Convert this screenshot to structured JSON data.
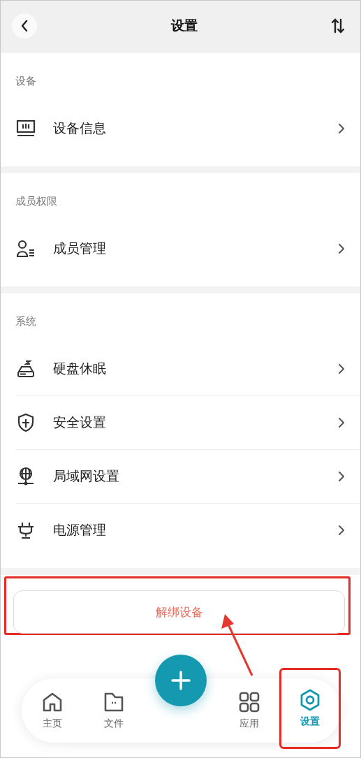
{
  "header": {
    "title": "设置"
  },
  "sections": [
    {
      "label": "设备",
      "items": [
        {
          "kind": "monitor",
          "label": "设备信息"
        }
      ]
    },
    {
      "label": "成员权限",
      "items": [
        {
          "kind": "members",
          "label": "成员管理"
        }
      ]
    },
    {
      "label": "系统",
      "items": [
        {
          "kind": "disk",
          "label": "硬盘休眠"
        },
        {
          "kind": "shield",
          "label": "安全设置"
        },
        {
          "kind": "network",
          "label": "局域网设置"
        },
        {
          "kind": "plug",
          "label": "电源管理"
        }
      ]
    }
  ],
  "unbind_button": {
    "label": "解绑设备",
    "highlighted": true
  },
  "tabs": [
    {
      "kind": "home",
      "label": "主页",
      "selected": false,
      "highlighted": false
    },
    {
      "kind": "files",
      "label": "文件",
      "selected": false,
      "highlighted": false
    },
    {
      "kind": "apps",
      "label": "应用",
      "selected": false,
      "highlighted": false
    },
    {
      "kind": "settings",
      "label": "设置",
      "selected": true,
      "highlighted": true
    }
  ]
}
